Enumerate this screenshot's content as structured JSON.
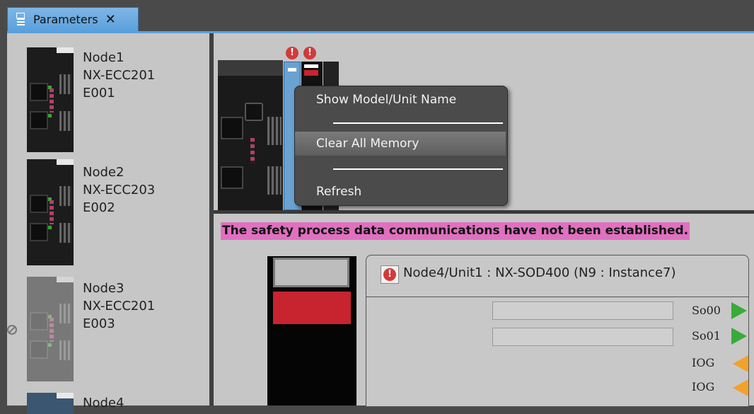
{
  "tab": {
    "label": "Parameters",
    "close": "✕"
  },
  "nodes": [
    {
      "name": "Node1",
      "model": "NX-ECC201",
      "id": "E001"
    },
    {
      "name": "Node2",
      "model": "NX-ECC203",
      "id": "E002"
    },
    {
      "name": "Node3",
      "model": "NX-ECC201",
      "id": "E003"
    },
    {
      "name": "Node4"
    }
  ],
  "context_menu": {
    "items": [
      {
        "label": "Show Model/Unit Name"
      },
      {
        "label": "Clear All Memory"
      },
      {
        "label": "Refresh"
      }
    ]
  },
  "warning": "The safety process data communications have not been established.",
  "unit": {
    "title": "Node4/Unit1 : NX-SOD400 (N9 : Instance7)",
    "error_glyph": "!",
    "ports": [
      {
        "label": "So00",
        "direction": "output",
        "value": ""
      },
      {
        "label": "So01",
        "direction": "output",
        "value": ""
      },
      {
        "label": "IOG",
        "direction": "input"
      },
      {
        "label": "IOG",
        "direction": "input"
      }
    ]
  },
  "colors": {
    "accent": "#5aa0dc",
    "warning_bg": "#e070c0",
    "output_arrow": "#3aaa3a",
    "input_arrow": "#f2a22a",
    "error": "#d23a3a"
  }
}
